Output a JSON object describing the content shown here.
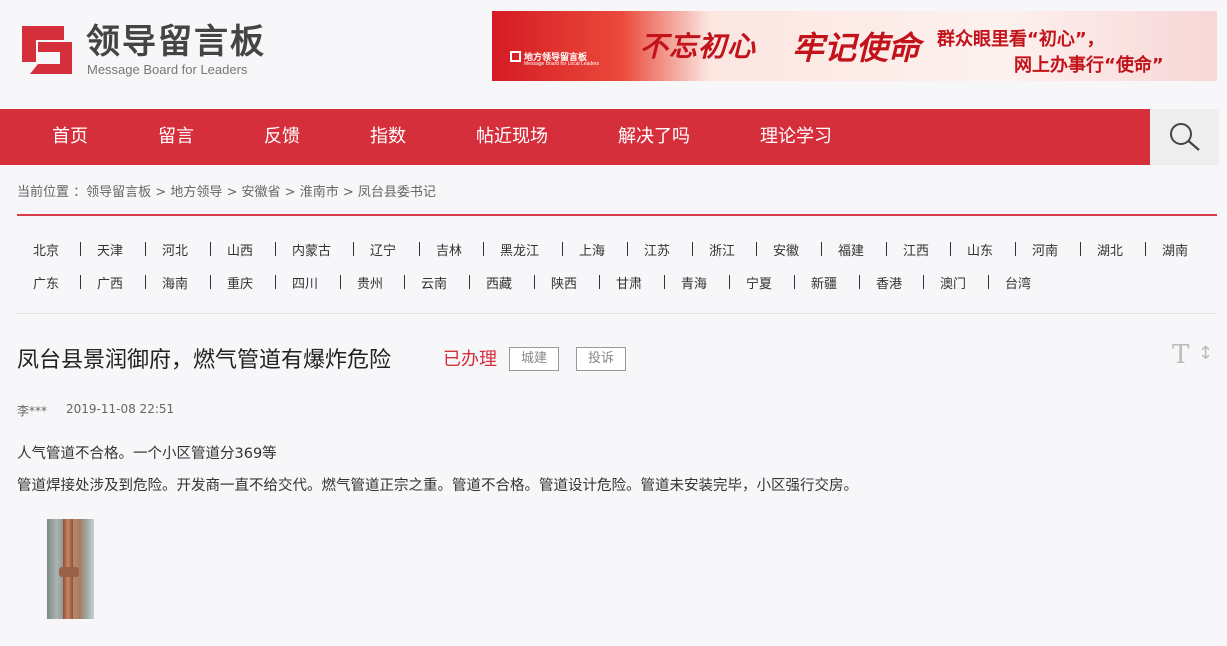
{
  "header": {
    "logo_title": "领导留言板",
    "logo_subtitle": "Message Board for Leaders",
    "banner": {
      "badge_title": "地方领导留言板",
      "badge_subtitle": "Message Board for Local Leaders",
      "calligraphy_1": "不忘初心",
      "calligraphy_2": "牢记使命",
      "line_1": "群众眼里看“初心”，",
      "line_2": "网上办事行“使命”"
    }
  },
  "nav": {
    "items": [
      {
        "label": "首页"
      },
      {
        "label": "留言"
      },
      {
        "label": "反馈"
      },
      {
        "label": "指数"
      },
      {
        "label": "帖近现场"
      },
      {
        "label": "解决了吗"
      },
      {
        "label": "理论学习"
      }
    ],
    "search_icon": "search-icon"
  },
  "breadcrumb": {
    "prefix": "当前位置 ：",
    "items": [
      "领导留言板",
      "地方领导",
      "安徽省",
      "淮南市",
      "凤台县委书记"
    ],
    "separator": " > "
  },
  "regions": {
    "row1": [
      "北京",
      "天津",
      "河北",
      "山西",
      "内蒙古",
      "辽宁",
      "吉林",
      "黑龙江",
      "上海",
      "江苏",
      "浙江",
      "安徽",
      "福建",
      "江西",
      "山东",
      "河南",
      "湖北",
      "湖南"
    ],
    "row2": [
      "广东",
      "广西",
      "海南",
      "重庆",
      "四川",
      "贵州",
      "云南",
      "西藏",
      "陕西",
      "甘肃",
      "青海",
      "宁夏",
      "新疆",
      "香港",
      "澳门",
      "台湾"
    ]
  },
  "post": {
    "title": "凤台县景润御府，燃气管道有爆炸危险",
    "status": "已办理",
    "tags": [
      "城建",
      "投诉"
    ],
    "font_toggle": "T",
    "author": "李***",
    "time": "2019-11-08 22:51",
    "body": [
      "人气管道不合格。一个小区管道分369等",
      "管道焊接处涉及到危险。开发商一直不给交代。燃气管道正宗之重。管道不合格。管道设计危险。管道未安装完毕，小区强行交房。"
    ]
  }
}
